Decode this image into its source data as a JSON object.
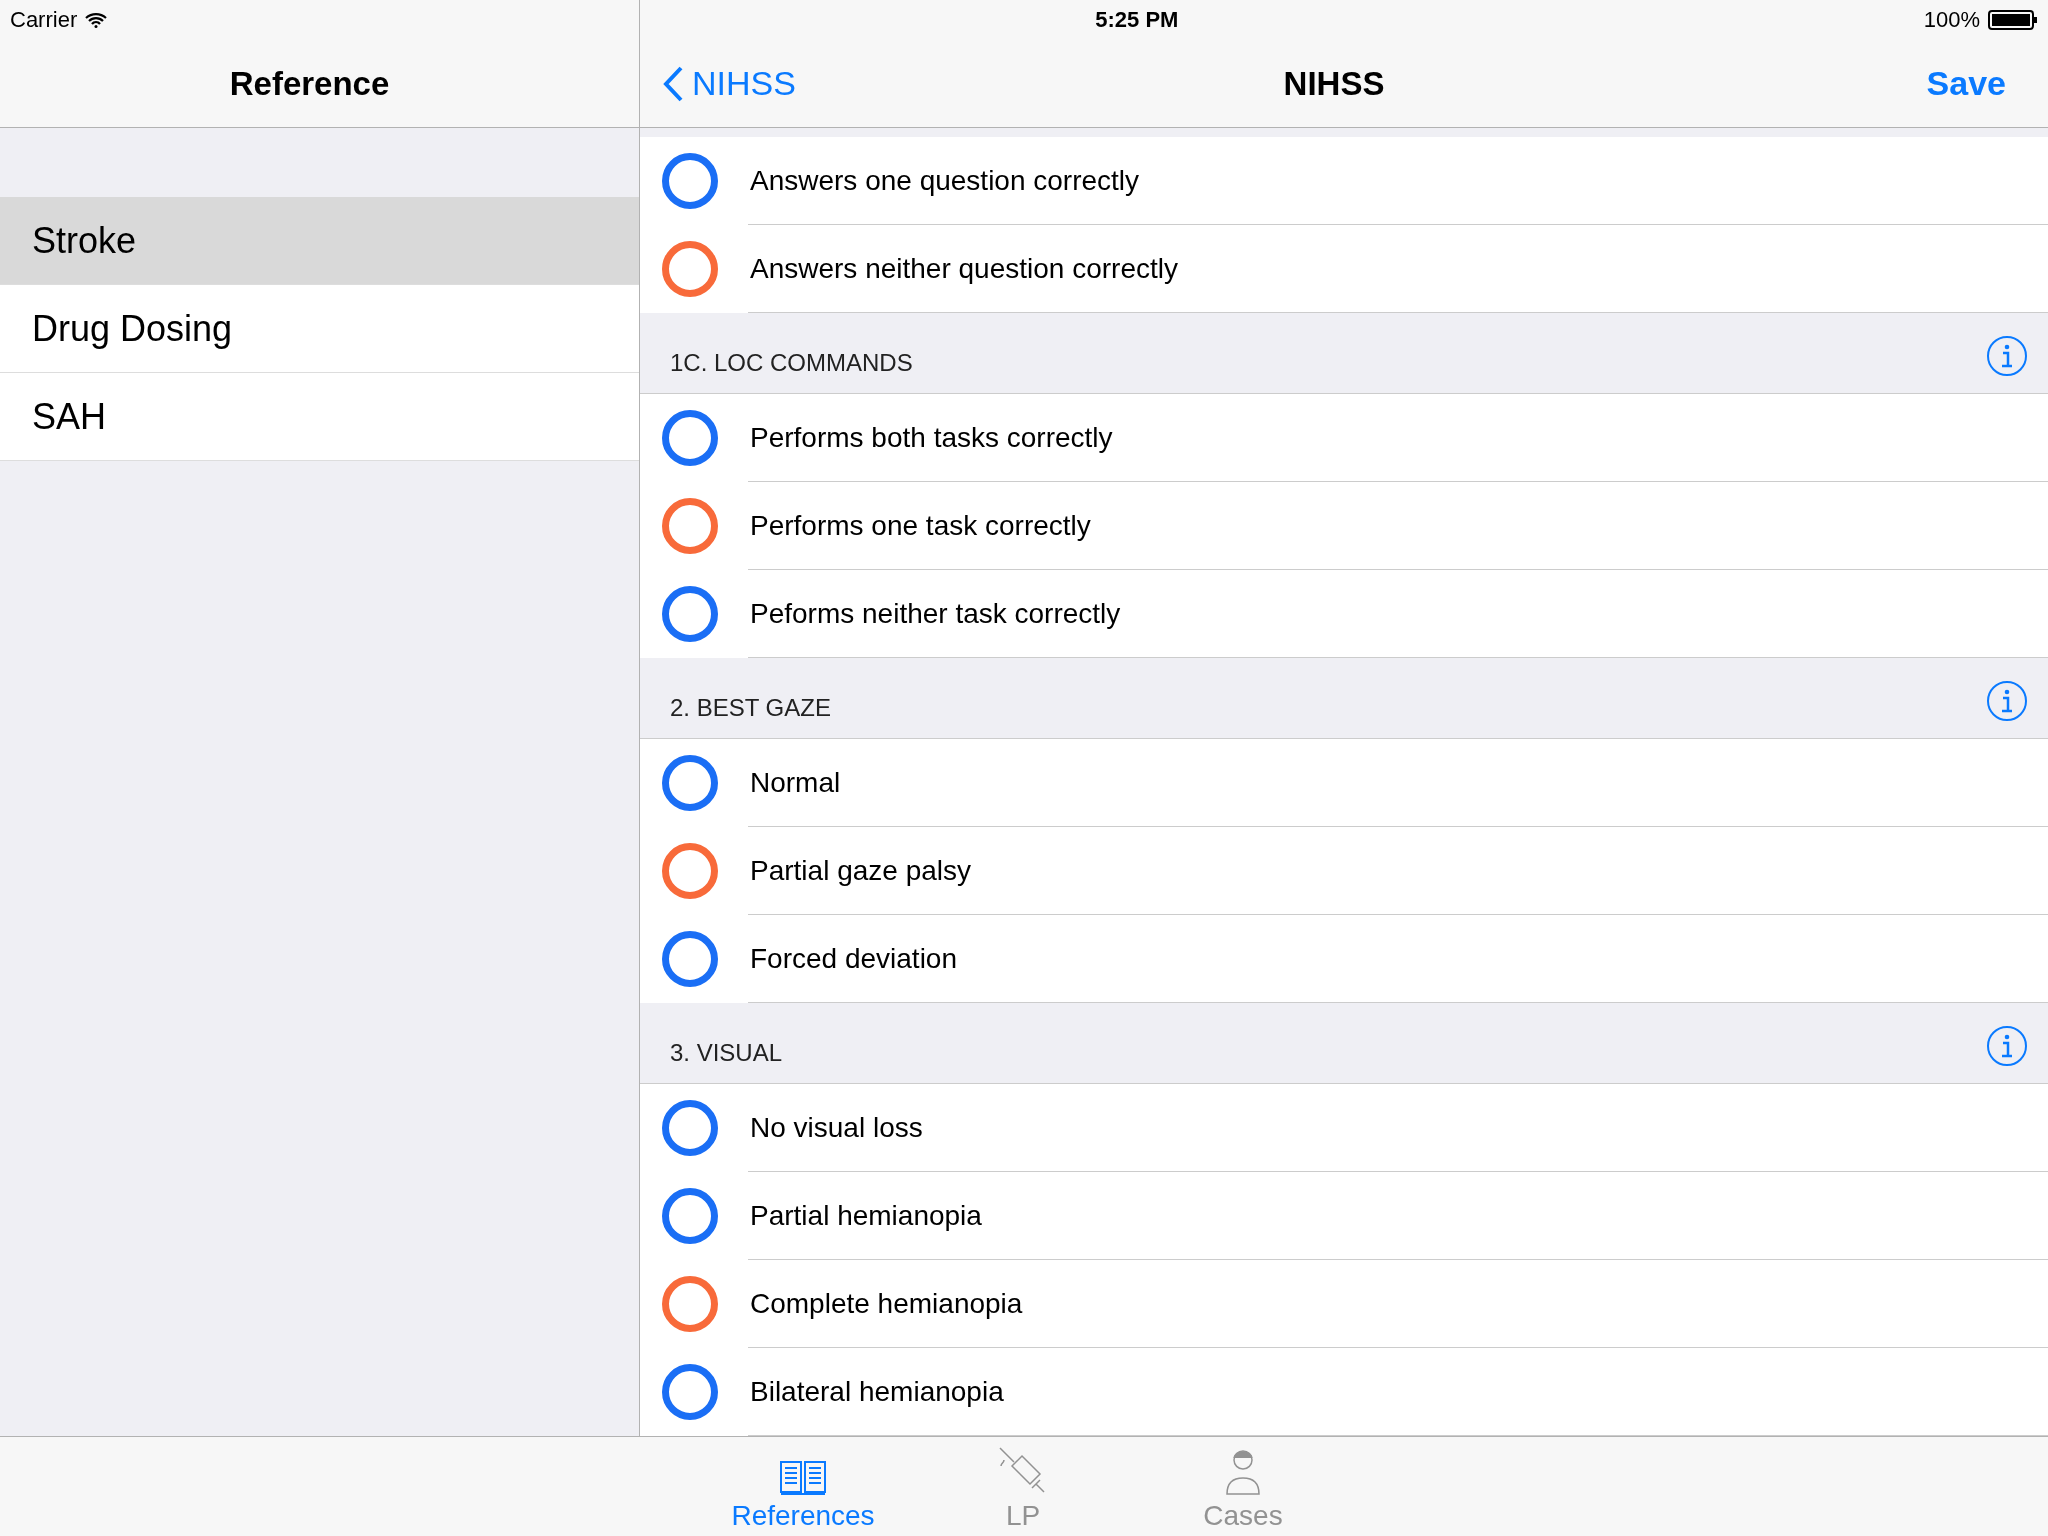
{
  "status_bar": {
    "carrier": "Carrier",
    "time": "5:25 PM",
    "battery": "100%"
  },
  "sidebar": {
    "title": "Reference",
    "items": [
      {
        "label": "Stroke",
        "selected": true
      },
      {
        "label": "Drug Dosing",
        "selected": false
      },
      {
        "label": "SAH",
        "selected": false
      }
    ]
  },
  "nav": {
    "back": "NIHSS",
    "title": "NIHSS",
    "action": "Save"
  },
  "list": [
    {
      "kind": "option",
      "label": "Answers one question correctly",
      "color": "#1a6ef5"
    },
    {
      "kind": "option",
      "label": "Answers neither question correctly",
      "color": "#f86a3a"
    },
    {
      "kind": "header",
      "label": "1C. LOC COMMANDS"
    },
    {
      "kind": "option",
      "label": "Performs both tasks correctly",
      "color": "#1a6ef5"
    },
    {
      "kind": "option",
      "label": "Performs one task correctly",
      "color": "#f86a3a"
    },
    {
      "kind": "option",
      "label": "Peforms neither task correctly",
      "color": "#1a6ef5"
    },
    {
      "kind": "header",
      "label": "2. BEST GAZE"
    },
    {
      "kind": "option",
      "label": "Normal",
      "color": "#1a6ef5"
    },
    {
      "kind": "option",
      "label": "Partial gaze palsy",
      "color": "#f86a3a"
    },
    {
      "kind": "option",
      "label": "Forced deviation",
      "color": "#1a6ef5"
    },
    {
      "kind": "header",
      "label": "3. VISUAL"
    },
    {
      "kind": "option",
      "label": "No visual loss",
      "color": "#1a6ef5"
    },
    {
      "kind": "option",
      "label": "Partial hemianopia",
      "color": "#1a6ef5"
    },
    {
      "kind": "option",
      "label": "Complete hemianopia",
      "color": "#f86a3a"
    },
    {
      "kind": "option",
      "label": "Bilateral hemianopia",
      "color": "#1a6ef5"
    }
  ],
  "tabs": [
    {
      "label": "References",
      "kind": "book",
      "selected": true
    },
    {
      "label": "LP",
      "kind": "syringe",
      "selected": false
    },
    {
      "label": "Cases",
      "kind": "person",
      "selected": false
    }
  ]
}
